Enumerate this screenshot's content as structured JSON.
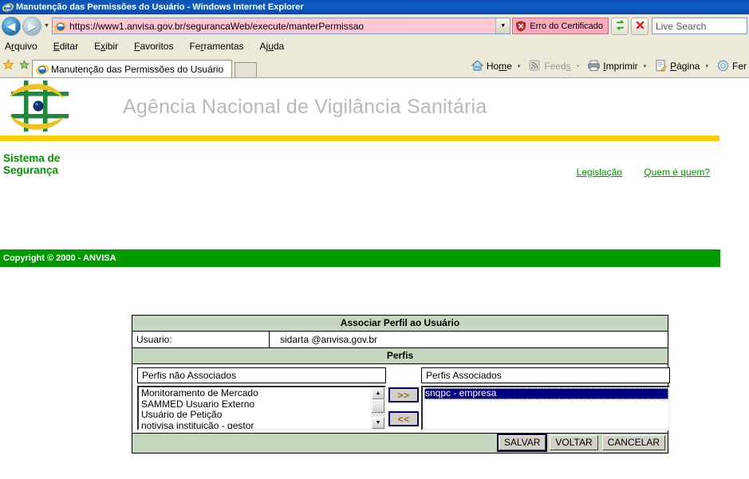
{
  "window": {
    "title": "Manutenção das Permissões do Usuário - Windows Internet Explorer",
    "ie_icon": "internet-explorer-icon"
  },
  "navbar": {
    "back_label": "◀",
    "forward_label": "▶",
    "history_caret": "▼",
    "url": "https://www1.anvisa.gov.br/segurancaWeb/execute/manterPermissao",
    "url_dropdown_caret": "▼",
    "certificate_error": "Erro do Certificado",
    "refresh_icon": "refresh-icon",
    "stop_icon": "stop-icon",
    "search_placeholder": "Live Search"
  },
  "menu": {
    "items": [
      {
        "pre": "A",
        "acc": "r",
        "post": "quivo"
      },
      {
        "pre": "",
        "acc": "E",
        "post": "ditar"
      },
      {
        "pre": "E",
        "acc": "x",
        "post": "ibir"
      },
      {
        "pre": "",
        "acc": "F",
        "post": "avoritos"
      },
      {
        "pre": "Fe",
        "acc": "r",
        "post": "ramentas"
      },
      {
        "pre": "Aj",
        "acc": "u",
        "post": "da"
      }
    ]
  },
  "tabbar": {
    "favorites_icon": "star-icon",
    "add_favorite_icon": "add-favorite-icon",
    "tab_title": "Manutenção das Permissões do Usuário",
    "new_tab_label": ""
  },
  "commandbar": {
    "items": [
      {
        "label": "Home",
        "pre": "Ho",
        "acc": "m",
        "post": "e",
        "icon": "home-icon",
        "caret": "▾",
        "disabled": false
      },
      {
        "label": "Feeds",
        "pre": "Feed",
        "acc": "s",
        "post": "",
        "icon": "feeds-icon",
        "caret": "▾",
        "disabled": true
      },
      {
        "label": "Imprimir",
        "pre": "",
        "acc": "I",
        "post": "mprimir",
        "icon": "printer-icon",
        "caret": "▾",
        "disabled": false
      },
      {
        "label": "Página",
        "pre": "",
        "acc": "P",
        "post": "ágina",
        "icon": "page-icon",
        "caret": "▾",
        "disabled": false
      },
      {
        "label": "Fer",
        "pre": "Fer",
        "acc": "",
        "post": "",
        "icon": "tools-icon",
        "caret": "",
        "disabled": false
      }
    ]
  },
  "site": {
    "logo_name": "anvisa-logo",
    "title": "Agência Nacional de Vigilância Sanitária",
    "system_line1": "Sistema de",
    "system_line2": "Segurança",
    "links": [
      {
        "label": "Legislação"
      },
      {
        "label": "Quem é quem?"
      }
    ]
  },
  "form": {
    "panel_title": "Associar Perfil ao Usuário",
    "user_label": "Usuario:",
    "user_value": "sidarta @anvisa.gov.br",
    "section_title": "Perfis",
    "available": {
      "header": "Perfis não Associados",
      "options": [
        "Monitoramento de Mercado",
        "SAMMED Usuario Externo",
        "Usuário de Petição",
        "notivisa instituição - gestor"
      ],
      "scroll_up": "▲",
      "scroll_down": "▼"
    },
    "associated": {
      "header": "Perfis Associados",
      "options": [
        "snqpc - empresa"
      ],
      "selected_index": 0
    },
    "add_button": ">>",
    "remove_button": "<<",
    "buttons": [
      {
        "label": "SALVAR",
        "focused": true
      },
      {
        "label": "VOLTAR",
        "focused": false
      },
      {
        "label": "CANCELAR",
        "focused": false
      }
    ]
  },
  "footer": {
    "copyright": "Copyright © 2000 - ANVISA"
  },
  "colors": {
    "anvisa_green": "#009900",
    "anvisa_yellow": "#ffcb05",
    "panel_green": "#c5d8bf",
    "selection_navy": "#000080",
    "cert_error_pink": "#ffa9bf",
    "address_pink": "#ffc6d6"
  }
}
